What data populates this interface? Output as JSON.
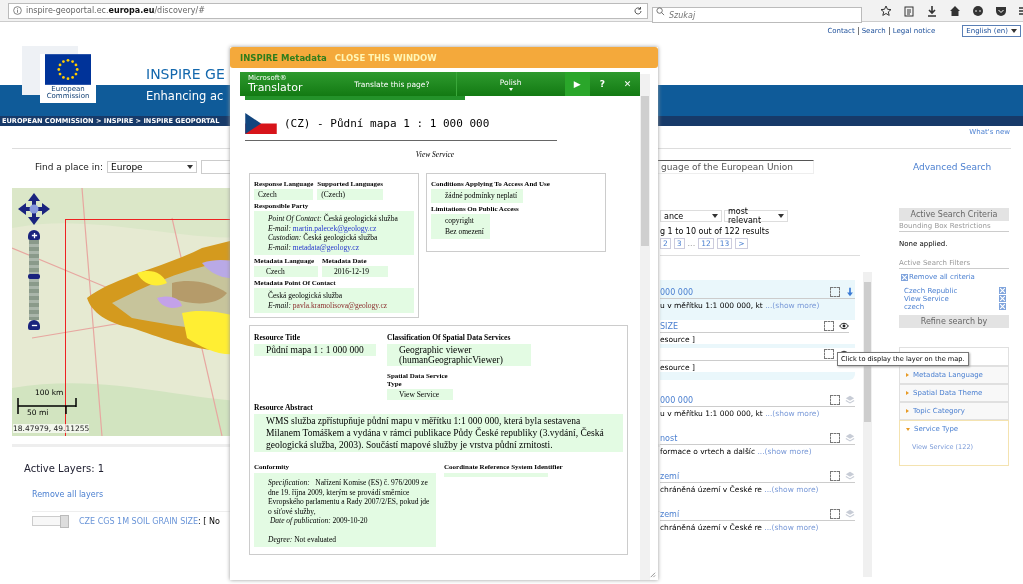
{
  "browser": {
    "url": "inspire-geoportal.ec.**europa.eu**/discovery/#",
    "search_placeholder": "Szukaj"
  },
  "top_links": [
    "Contact",
    "Search",
    "Legal notice"
  ],
  "language": "English (en)",
  "header": {
    "logo_text": "European Commission",
    "title": "INSPIRE GE",
    "subtitle": "Enhancing ac",
    "breadcrumb": "EUROPEAN COMMISSION > INSPIRE > INSPIRE GEOPORTAL",
    "whats_new": "What's new"
  },
  "find": {
    "label": "Find a place in:",
    "region": "Europe",
    "query_placeholder": "guage of the European Union",
    "advanced": "Advanced Search"
  },
  "map": {
    "zoom": {
      "level": 0.55
    },
    "scale_km": "100 km",
    "scale_mi": "50 mi",
    "coords": "18.47979, 49.11255"
  },
  "layers": {
    "title": "Active Layers: 1",
    "remove": "Remove all layers",
    "items": [
      {
        "name": "CZE CGS 1M SOIL GRAIN SIZE",
        "rest": ": [ No",
        "level": 1
      }
    ]
  },
  "results": {
    "sort": [
      "ance",
      "most relevant"
    ],
    "count": "g 1 to 10 out of 122 results",
    "pages": [
      {
        "label": "2",
        "kind": "link"
      },
      {
        "label": "3",
        "kind": "link"
      },
      {
        "label": "...",
        "kind": "gap"
      },
      {
        "label": "12",
        "kind": "link"
      },
      {
        "label": "13",
        "kind": "link"
      },
      {
        "label": ">",
        "kind": "link"
      }
    ],
    "items": [
      {
        "title": "000 000",
        "text": "u v měřítku 1:1 000 000, kt",
        "more": "...(show more)",
        "kind": "download",
        "expanded": true,
        "checked": false,
        "layers": [
          {
            "title": "SIZE",
            "text": "esource ]",
            "checked": false
          },
          {
            "text": "esource ]",
            "checked": false
          }
        ]
      },
      {
        "title": "000 000",
        "text": "u v měřítku 1:1 000 000, kt",
        "more": "...(show more)",
        "kind": "layers",
        "expanded": false,
        "checked": false
      },
      {
        "title": "nost",
        "text": "formace o vrtech a dalšíc",
        "more": "...(show more)",
        "kind": "layers",
        "expanded": false,
        "checked": false
      },
      {
        "title": "zemí",
        "text": "chráněná území v České re",
        "more": "...(show more)",
        "kind": "layers",
        "expanded": false,
        "checked": false
      },
      {
        "title": "zemí",
        "text": "chráněná území v České re",
        "more": "...(show more)",
        "kind": "layers",
        "expanded": false,
        "checked": false
      }
    ]
  },
  "tooltip": "Click to display the layer on the map.",
  "sidebar": {
    "criteria_title": "Active Search Criteria",
    "bbox_title": "Bounding Box Restrictions",
    "bbox_value": "None applied.",
    "filters_title": "Active Search Filters",
    "remove_all": "Remove all criteria",
    "filters": [
      "Czech Republic",
      "View Service",
      "czech"
    ],
    "refine": "Refine search by",
    "facets": [
      {
        "label": "Metadata Language",
        "expanded": false
      },
      {
        "label": "Spatial Data Theme",
        "expanded": false
      },
      {
        "label": "Topic Category",
        "expanded": false
      },
      {
        "label": "Service Type",
        "expanded": true,
        "options": [
          "View Service (122)"
        ]
      }
    ]
  },
  "modal": {
    "tab": "INSPIRE Metadata",
    "close": "CLOSE THIS WINDOW",
    "translator": {
      "brand_small": "Microsoft®",
      "brand": "Translator",
      "prompt": "Translate this page?",
      "language": "Polish",
      "go": "▶",
      "help": "?",
      "close": "✕"
    },
    "title": "(CZ) - Půdní mapa 1 : 1 000 000",
    "type": "View Service",
    "response_language": {
      "label": "Response Language",
      "value": "Czech"
    },
    "supported_languages": {
      "label": "Supported Languages",
      "value": "(Czech)"
    },
    "responsible_party": {
      "label": "Responsible Party",
      "contacts": [
        {
          "role": "Point Of Contact:",
          "org": "Česká geologická služba",
          "email_label": "E-mail:",
          "email": "martin.palecek@geology.cz",
          "visited": false
        },
        {
          "role": "Custodian:",
          "org": "Česká geologická služba",
          "email_label": "E-mail:",
          "email": "metadata@geology.cz",
          "visited": false
        }
      ]
    },
    "metadata_language": {
      "label": "Metadata Language",
      "value": "Czech"
    },
    "metadata_date": {
      "label": "Metadata Date",
      "value": "2016-12-19"
    },
    "metadata_contact": {
      "label": "Metadata Point Of Contact",
      "org": "Česká geologická služba",
      "email_label": "E-mail:",
      "email": "pavla.kramolisova@geology.cz",
      "visited": true
    },
    "conditions": {
      "label": "Conditions Applying To Access And Use",
      "values": [
        "žádné podmínky neplatí"
      ]
    },
    "limitations": {
      "label": "Limitations On Public Access",
      "values": [
        "copyright",
        "Bez omezení"
      ]
    },
    "resource_title": {
      "label": "Resource Title",
      "value": "Půdní mapa 1 : 1 000 000"
    },
    "classification": {
      "label": "Classification Of Spatial Data Services",
      "value": "Geographic viewer (humanGeographicViewer)"
    },
    "service_type": {
      "label": "Spatial Data Service Type",
      "value": "View Service"
    },
    "abstract": {
      "label": "Resource Abstract",
      "value": "WMS služba zpřístupňuje půdní mapu v měřítku 1:1 000 000, která byla sestavena Milanem Tomáškem a vydána v rámci publikace Půdy České republiky (3.vydání, Česká geologická služba, 2003). Součástí mapové služby je vrstva půdní zrnitosti."
    },
    "conformity": {
      "label": "Conformity",
      "spec_label": "Specification:",
      "spec": "Nařízení Komise (ES) č. 976/2009 ze dne 19. října 2009, kterým se provádí směrnice Evropského parlamentu a Rady 2007/2/ES, pokud jde o síťové služby,",
      "date_label": "Date of publication:",
      "date": "2009-10-20",
      "degree_label": "Degree:",
      "degree": "Not evaluated"
    },
    "crs": {
      "label": "Coordinate Reference System Identifier"
    }
  }
}
